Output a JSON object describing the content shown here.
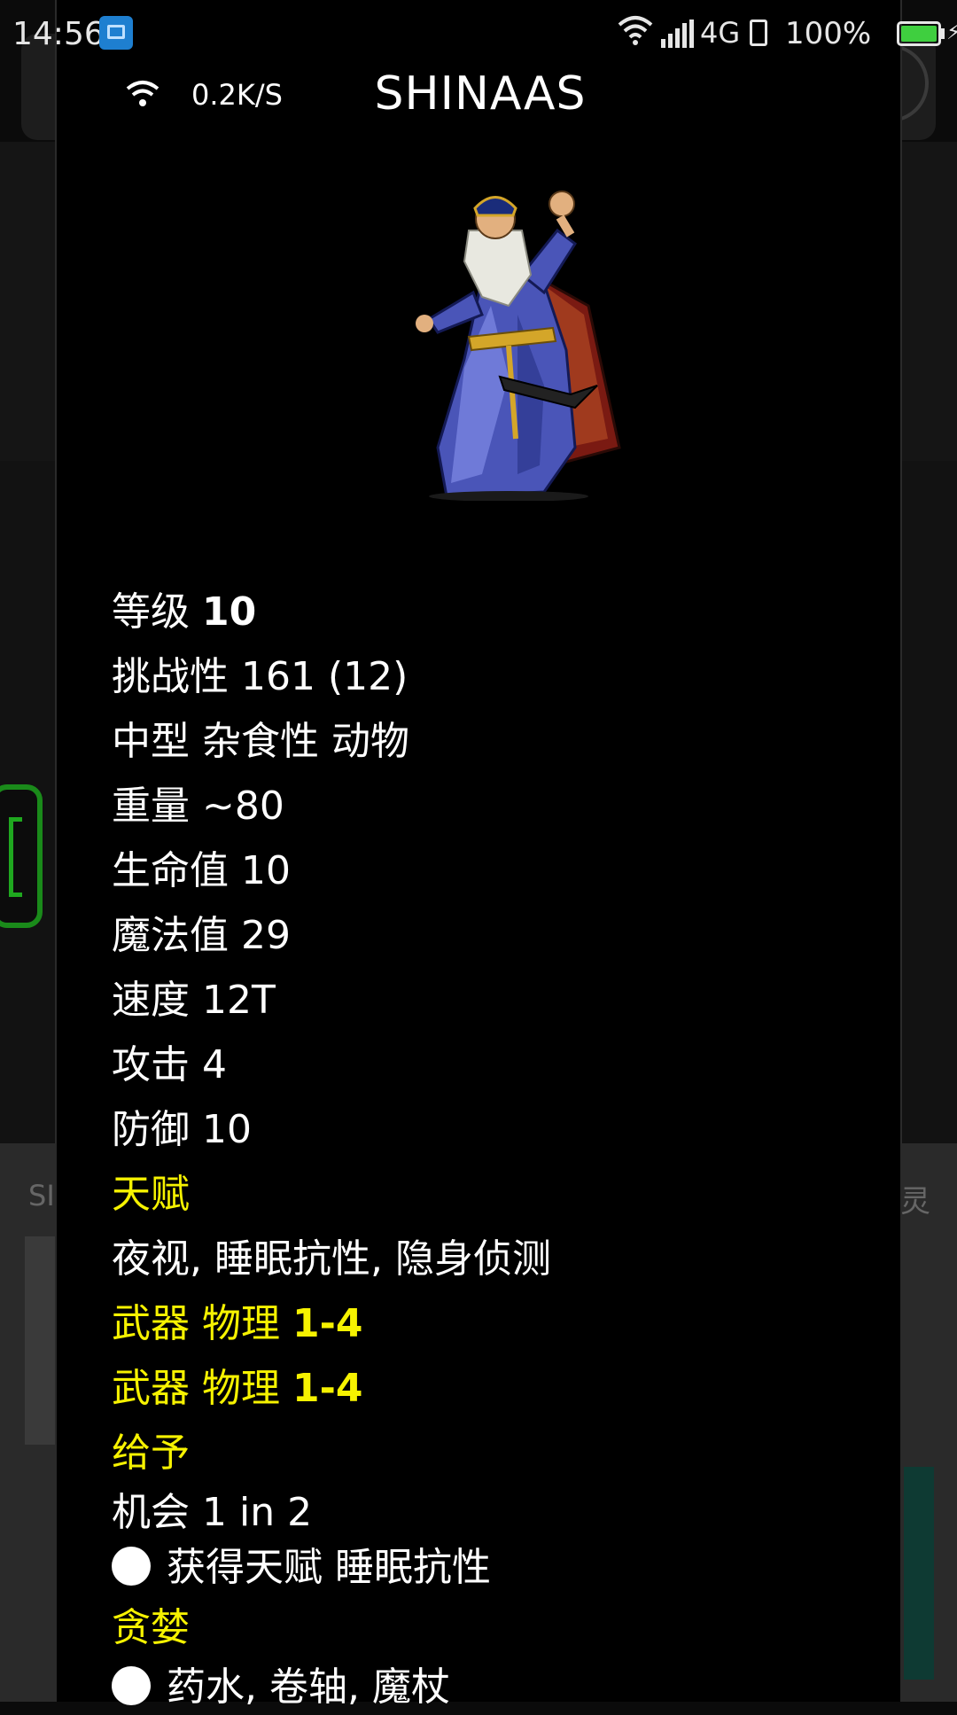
{
  "status_bar": {
    "time": "14:56",
    "network": "4G",
    "battery": "100%",
    "battery_level": 1.0
  },
  "background": {
    "left_text": "SI",
    "right_text": "灵"
  },
  "dialog": {
    "net_speed": "0.2K/S",
    "title": "SHINAAS",
    "portrait_icon": "wizard-portrait",
    "level_label": "等级",
    "level_value": "10",
    "challenge": "挑战性 161 (12)",
    "size_diet_type": "中型 杂食性 动物",
    "weight": "重量 ~80",
    "hp": "生命值 10",
    "mp": "魔法值 29",
    "speed": "速度 12T",
    "attack": "攻击 4",
    "defense": "防御 10",
    "talents_heading": "天赋",
    "talents": "夜视, 睡眠抗性, 隐身侦测",
    "weapon1_label": "武器 物理",
    "weapon1_value": "1-4",
    "weapon2_label": "武器 物理",
    "weapon2_value": "1-4",
    "grants_heading": "给予",
    "grant_chance": "机会 1 in 2",
    "grant_item": "获得天赋 睡眠抗性",
    "greed_heading": "贪婪",
    "greed_item": "药水, 卷轴, 魔杖"
  },
  "colors": {
    "heading": "#f6f200",
    "text": "#ffffff",
    "background": "#000000"
  }
}
